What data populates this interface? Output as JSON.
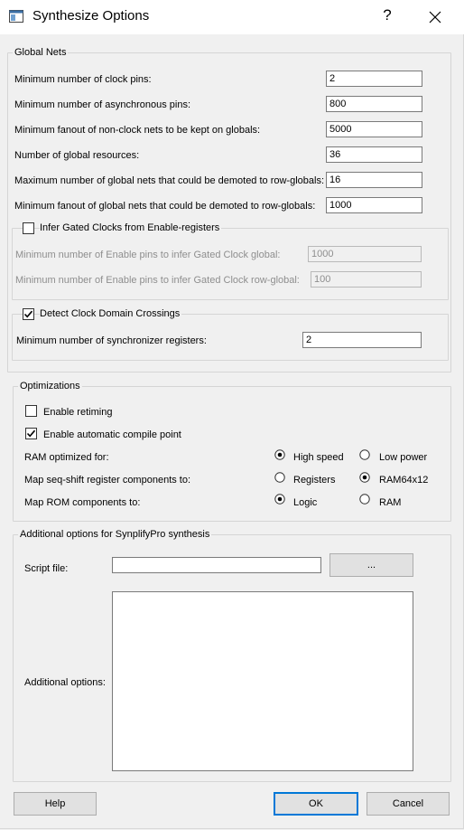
{
  "window": {
    "title": "Synthesize Options",
    "help_glyph": "?",
    "icons": {
      "app": "app-window-icon",
      "close": "close-icon"
    }
  },
  "global_nets": {
    "legend": "Global Nets",
    "fields": [
      {
        "label": "Minimum number of clock pins:",
        "value": "2"
      },
      {
        "label": "Minimum number of asynchronous pins:",
        "value": "800"
      },
      {
        "label": "Minimum fanout of non-clock nets to be kept on globals:",
        "value": "5000"
      },
      {
        "label": "Number of global resources:",
        "value": "36"
      },
      {
        "label": "Maximum number of global nets that could be demoted to row-globals:",
        "value": "16"
      },
      {
        "label": "Minimum fanout of global nets that could be demoted to row-globals:",
        "value": "1000"
      }
    ],
    "gated_clocks": {
      "label": "Infer Gated Clocks from Enable-registers",
      "checked": false,
      "fields": [
        {
          "label": "Minimum number of Enable pins to infer Gated Clock global:",
          "value": "1000"
        },
        {
          "label": "Minimum number of Enable pins to infer Gated Clock row-global:",
          "value": "100"
        }
      ]
    },
    "clock_domain": {
      "label": "Detect Clock Domain Crossings",
      "checked": true,
      "fields": [
        {
          "label": "Minimum number of synchronizer registers:",
          "value": "2"
        }
      ]
    }
  },
  "optimizations": {
    "legend": "Optimizations",
    "enable_retiming": {
      "label": "Enable retiming",
      "checked": false
    },
    "auto_compile_point": {
      "label": "Enable automatic compile point",
      "checked": true
    },
    "ram": {
      "label": "RAM optimized for:",
      "options": [
        "High speed",
        "Low power"
      ],
      "selected": "High speed"
    },
    "seq_shift": {
      "label": "Map seq-shift register components to:",
      "options": [
        "Registers",
        "RAM64x12"
      ],
      "selected": "RAM64x12"
    },
    "rom": {
      "label": "Map ROM components to:",
      "options": [
        "Logic",
        "RAM"
      ],
      "selected": "Logic"
    }
  },
  "additional": {
    "legend": "Additional options for SynplifyPro synthesis",
    "script_file_label": "Script file:",
    "script_file_value": "",
    "browse_label": "...",
    "additional_options_label": "Additional options:",
    "additional_options_value": ""
  },
  "buttons": {
    "help": "Help",
    "ok": "OK",
    "cancel": "Cancel"
  }
}
